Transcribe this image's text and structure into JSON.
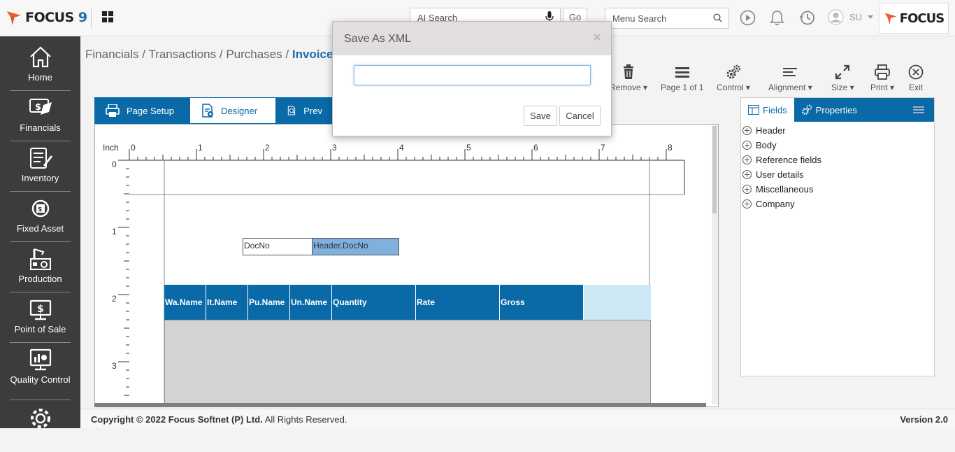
{
  "header": {
    "logo_text": "FOCUS",
    "logo_num": "9",
    "ai_search_placeholder": "AI Search",
    "go_label": "Go",
    "menu_search_placeholder": "Menu Search",
    "user_initials": "SU",
    "brand_text": "FOCUS"
  },
  "sidebar": {
    "items": [
      {
        "label": "Home",
        "icon": "home-icon"
      },
      {
        "label": "Financials",
        "icon": "financials-icon"
      },
      {
        "label": "Inventory",
        "icon": "inventory-icon"
      },
      {
        "label": "Fixed Asset",
        "icon": "fixed-asset-icon"
      },
      {
        "label": "Production",
        "icon": "production-icon"
      },
      {
        "label": "Point of Sale",
        "icon": "pos-icon"
      },
      {
        "label": "Quality Control",
        "icon": "quality-control-icon"
      },
      {
        "label": "",
        "icon": "settings-icon"
      }
    ]
  },
  "breadcrumb": {
    "items": [
      "Financials",
      "Transactions",
      "Purchases"
    ],
    "separator": "/",
    "current": "Invoice D"
  },
  "designer_tabs": [
    {
      "label": "Page Setup",
      "icon": "printer-icon"
    },
    {
      "label": "Designer",
      "icon": "designer-icon"
    },
    {
      "label": "Prev",
      "icon": "preview-icon"
    }
  ],
  "toolbar": {
    "remove": "Remove",
    "page": "Page 1 of 1",
    "control": "Control",
    "alignment": "Alignment",
    "size": "Size",
    "print": "Print",
    "exit": "Exit"
  },
  "ruler": {
    "unit": "Inch",
    "h_ticks": [
      "0",
      "1",
      "2",
      "3",
      "4",
      "5",
      "6",
      "7",
      "8"
    ],
    "v_ticks": [
      "0",
      "1",
      "2",
      "3"
    ]
  },
  "design": {
    "label_field": "DocNo",
    "value_field": "Header.DocNo",
    "columns": [
      "Wa.Name",
      "It.Name",
      "Pu.Name",
      "Un.Name",
      "Quantity",
      "Rate",
      "Gross"
    ]
  },
  "fields_panel": {
    "tab_fields": "Fields",
    "tab_properties": "Properties",
    "items": [
      "Header",
      "Body",
      "Reference fields",
      "User details",
      "Miscellaneous",
      "Company"
    ]
  },
  "footer": {
    "copyright_prefix": "Copyright © 2022",
    "company": "Focus Softnet (P) Ltd.",
    "rights": "All Rights Reserved.",
    "version": "Version 2.0"
  },
  "dialog": {
    "title": "Save As XML",
    "input_value": "",
    "save_label": "Save",
    "cancel_label": "Cancel",
    "close_symbol": "×"
  },
  "colors": {
    "primary": "#0a6aa8",
    "sidebar": "#3c3c3c",
    "accent_orange": "#e8602c"
  }
}
